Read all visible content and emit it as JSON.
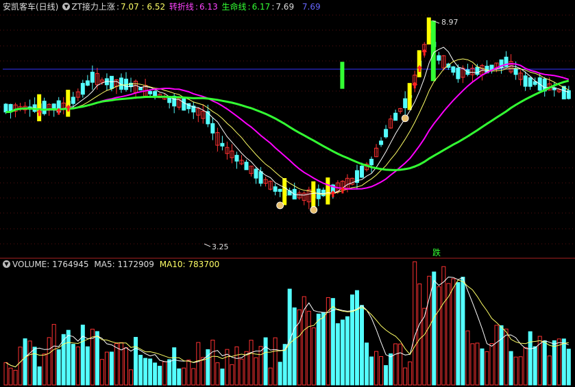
{
  "header": {
    "title": "安凯客车(日线)",
    "zt_label": "ZT接力上涨",
    "zt_values": "7.07 : 6.52",
    "turn_label": "转折线",
    "turn_value": "6.13",
    "life_label": "生命线",
    "life_value": "6.17",
    "extra1": "7.69",
    "extra2": "7.69"
  },
  "annotations": {
    "high_label": "8.97",
    "low_label": "3.25",
    "signal_label": "跌"
  },
  "volume": {
    "label": "VOLUME: 1764945",
    "ma5": "MA5: 1172909",
    "ma10": "MA10: 783700"
  },
  "colors": {
    "up": "#ff3232",
    "down": "#54ffff",
    "zt": "#ffff00",
    "zt_big": "#33ff33",
    "turn_line": "#ff00ff",
    "life_line": "#33ff33",
    "ma_white": "#ffffff",
    "ma_yellow": "#ffff66",
    "ref_line": "#3333ff"
  },
  "icons": {
    "indicator_toggle": "chevron-down-icon",
    "money_bag": "money-bag-icon",
    "up_arrow": "up-arrow-icon"
  }
}
